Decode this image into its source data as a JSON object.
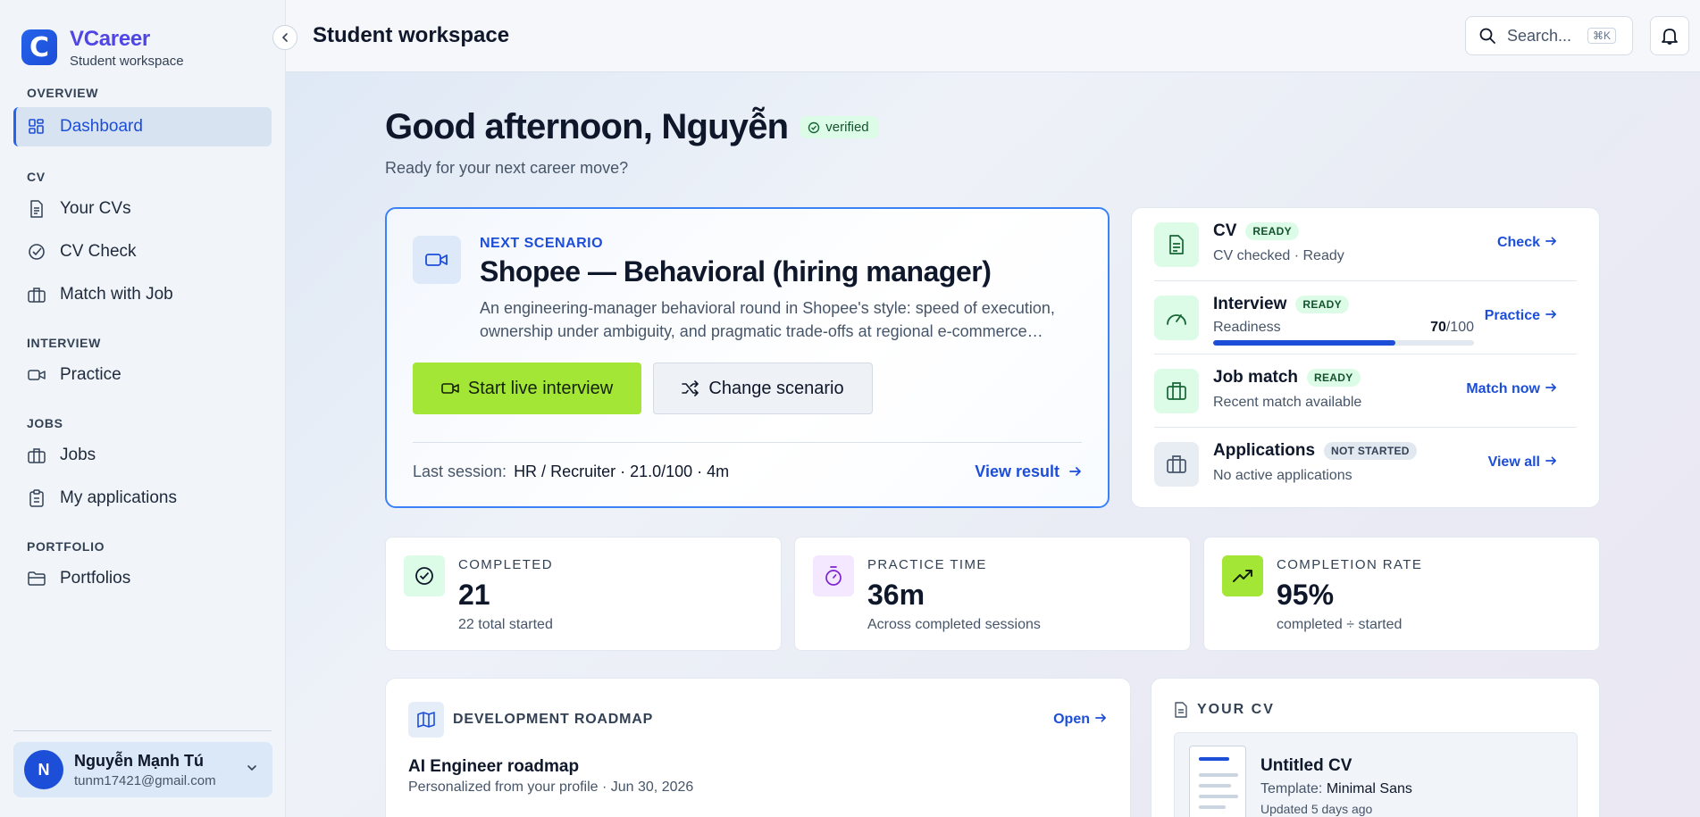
{
  "brand": {
    "name": "VCareer",
    "subtitle": "Student workspace",
    "logo_letter": "C"
  },
  "sidebar": {
    "sections": [
      {
        "title": "OVERVIEW",
        "items": [
          {
            "label": "Dashboard",
            "icon": "grid-icon",
            "active": true
          }
        ]
      },
      {
        "title": "CV",
        "items": [
          {
            "label": "Your CVs",
            "icon": "document-icon"
          },
          {
            "label": "CV Check",
            "icon": "check-circle-icon"
          },
          {
            "label": "Match with Job",
            "icon": "briefcase-icon"
          }
        ]
      },
      {
        "title": "INTERVIEW",
        "items": [
          {
            "label": "Practice",
            "icon": "video-icon"
          }
        ]
      },
      {
        "title": "JOBS",
        "items": [
          {
            "label": "Jobs",
            "icon": "briefcase-icon"
          },
          {
            "label": "My applications",
            "icon": "clipboard-icon"
          }
        ]
      },
      {
        "title": "PORTFOLIO",
        "items": [
          {
            "label": "Portfolios",
            "icon": "folder-icon"
          }
        ]
      }
    ],
    "user": {
      "initial": "N",
      "name": "Nguyễn Mạnh Tú",
      "email": "tunm17421@gmail.com"
    }
  },
  "topbar": {
    "title": "Student workspace",
    "search_placeholder": "Search...",
    "search_shortcut": "⌘K"
  },
  "greeting": {
    "title": "Good afternoon, Nguyễn",
    "badge": "verified",
    "subtitle": "Ready for your next career move?"
  },
  "scenario": {
    "kicker": "NEXT SCENARIO",
    "title": "Shopee — Behavioral (hiring manager)",
    "description": "An engineering-manager behavioral round in Shopee's style: speed of execution, ownership under ambiguity, and pragmatic trade-offs at regional e-commerce…",
    "start_label": "Start live interview",
    "change_label": "Change scenario",
    "last_session_label": "Last session:",
    "last_session_value": "HR / Recruiter · 21.0/100 · 4m",
    "view_result_label": "View result"
  },
  "status": [
    {
      "name": "CV",
      "badge": "READY",
      "sub": "CV checked · Ready",
      "action": "Check",
      "icon": "document-icon",
      "colors": {
        "bg": "#dcfce7",
        "fg": "#166534"
      }
    },
    {
      "name": "Interview",
      "badge": "READY",
      "progress_label": "Readiness",
      "progress_value": "70",
      "progress_max": "/100",
      "progress_fraction": 0.7,
      "action": "Practice",
      "icon": "gauge-icon"
    },
    {
      "name": "Job match",
      "badge": "READY",
      "sub": "Recent match available",
      "action": "Match now",
      "icon": "briefcase-icon"
    },
    {
      "name": "Applications",
      "badge": "NOT STARTED",
      "sub": "No active applications",
      "action": "View all",
      "icon": "briefcase-icon"
    }
  ],
  "stats": [
    {
      "label": "COMPLETED",
      "value": "21",
      "sub": "22 total started",
      "icon": "check-circle-icon",
      "icon_bg": "#dcfce7",
      "icon_fg": "#166534"
    },
    {
      "label": "PRACTICE TIME",
      "value": "36m",
      "sub": "Across completed sessions",
      "icon": "timer-icon",
      "icon_bg": "#f3e8ff",
      "icon_fg": "#7e22ce"
    },
    {
      "label": "COMPLETION RATE",
      "value": "95%",
      "sub": "completed ÷ started",
      "icon": "trending-up-icon",
      "icon_bg": "#a3e635",
      "icon_fg": "#14210a"
    }
  ],
  "roadmap": {
    "kicker": "DEVELOPMENT ROADMAP",
    "action": "Open",
    "title": "AI Engineer roadmap",
    "subtitle": "Personalized from your profile · Jun 30, 2026"
  },
  "your_cv": {
    "kicker": "YOUR CV",
    "name": "Untitled CV",
    "template_label": "Template:",
    "template_value": "Minimal Sans",
    "updated": "Updated 5 days ago"
  },
  "colors": {
    "accent": "#1d4ed8",
    "lime": "#a3e635",
    "ready_bg": "#dcfce7"
  }
}
